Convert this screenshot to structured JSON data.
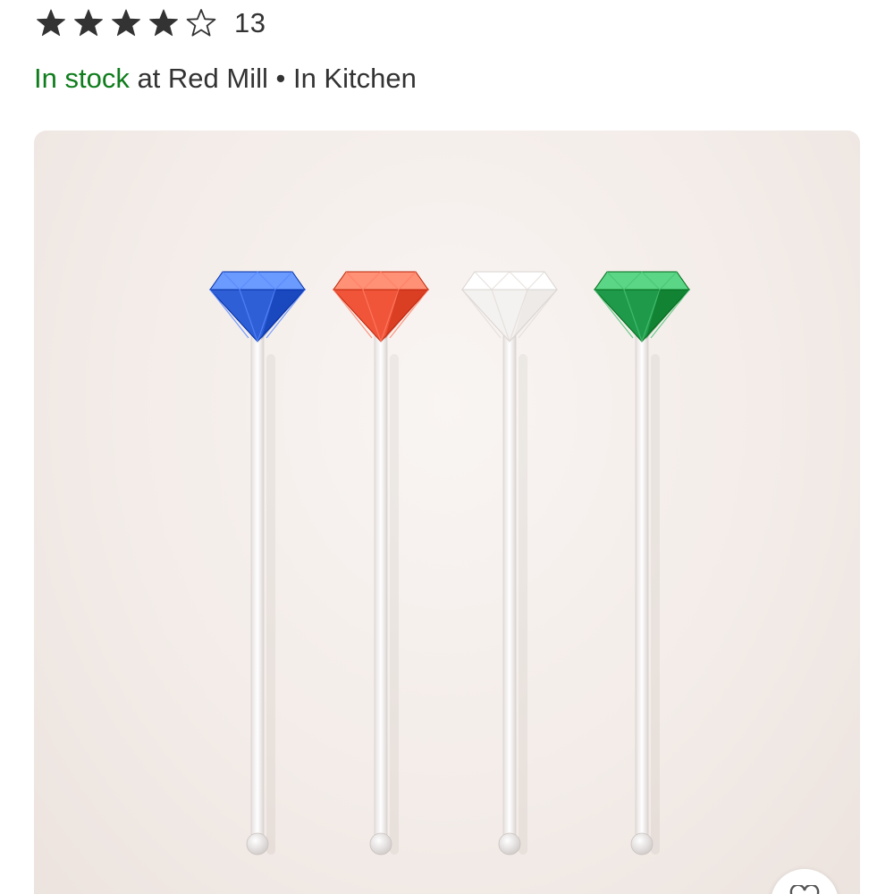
{
  "rating": {
    "value": 4,
    "max": 5,
    "review_count": "13",
    "filled_color": "#333333"
  },
  "availability": {
    "status": "In stock",
    "store_text": " at Red Mill • In Kitchen",
    "status_color": "#0f7d1c"
  },
  "product_image": {
    "items": [
      {
        "name": "blue-gem-stirrer",
        "color": "#2f5fd6"
      },
      {
        "name": "red-gem-stirrer",
        "color": "#f0553a"
      },
      {
        "name": "clear-gem-stirrer",
        "color": "#f4f2f0"
      },
      {
        "name": "green-gem-stirrer",
        "color": "#1f9a4a"
      }
    ]
  },
  "icons": {
    "star": "star-icon",
    "favorite": "heart-icon"
  }
}
